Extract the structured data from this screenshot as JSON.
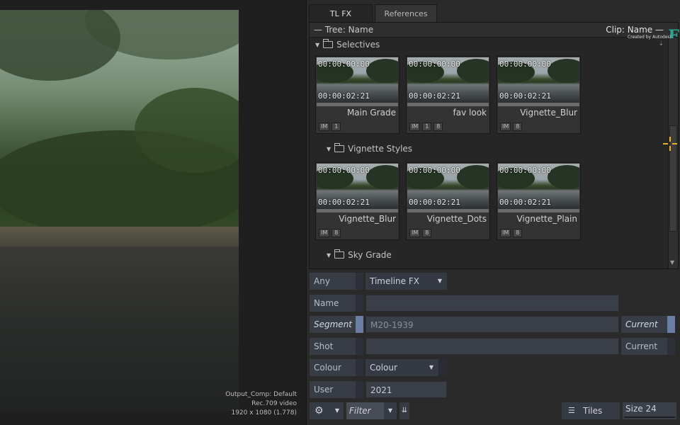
{
  "viewer": {
    "output_info": [
      "Output_Comp: Default",
      "Rec.709 video",
      "1920 x 1080 (1.778)"
    ]
  },
  "tabs": [
    {
      "label": "TL FX",
      "active": true
    },
    {
      "label": "References",
      "active": false
    }
  ],
  "browser": {
    "tree_label": "— Tree: Name",
    "clip_label": "Clip: Name —",
    "credit": "Created by Autodesk",
    "logo_letter": "F",
    "folders": {
      "selectives": "Selectives",
      "vignette_styles": "Vignette Styles",
      "sky_grade": "Sky Grade"
    },
    "tiles": [
      {
        "tc_in": "00:00:00:00",
        "tc_out": "00:00:02:21",
        "name": "Main Grade",
        "badges": [
          "IM",
          "1"
        ]
      },
      {
        "tc_in": "00:00:00:00",
        "tc_out": "00:00:02:21",
        "name": "fav look",
        "badges": [
          "IM",
          "1",
          "8"
        ]
      },
      {
        "tc_in": "00:00:00:00",
        "tc_out": "00:00:02:21",
        "name": "Vignette_Blur",
        "badges": [
          "IM",
          "8"
        ]
      },
      {
        "tc_in": "00:00:00:00",
        "tc_out": "00:00:02:21",
        "name": "Vignette_Blur",
        "badges": [
          "IM",
          "8"
        ]
      },
      {
        "tc_in": "00:00:00:00",
        "tc_out": "00:00:02:21",
        "name": "Vignette_Dots",
        "badges": [
          "IM",
          "8"
        ]
      },
      {
        "tc_in": "00:00:00:00",
        "tc_out": "00:00:02:21",
        "name": "Vignette_Plain",
        "badges": [
          "IM",
          "8"
        ]
      }
    ]
  },
  "filters": {
    "any_label": "Any",
    "scope_select": "Timeline FX",
    "name_label": "Name",
    "name_value": "",
    "segment_label": "Segment",
    "segment_value": "M20-1939",
    "segment_current": "Current",
    "shot_label": "Shot",
    "shot_value": "",
    "shot_current": "Current",
    "colour_label": "Colour",
    "colour_select": "Colour",
    "user_label": "User",
    "user_value": "2021"
  },
  "bottom_bar": {
    "filter_label": "Filter",
    "tiles_label": "Tiles",
    "size_label": "Size 24"
  },
  "colors": {
    "accent": "#6c7da3",
    "logo": "#2fa595",
    "crosshair": "#e8b020"
  }
}
